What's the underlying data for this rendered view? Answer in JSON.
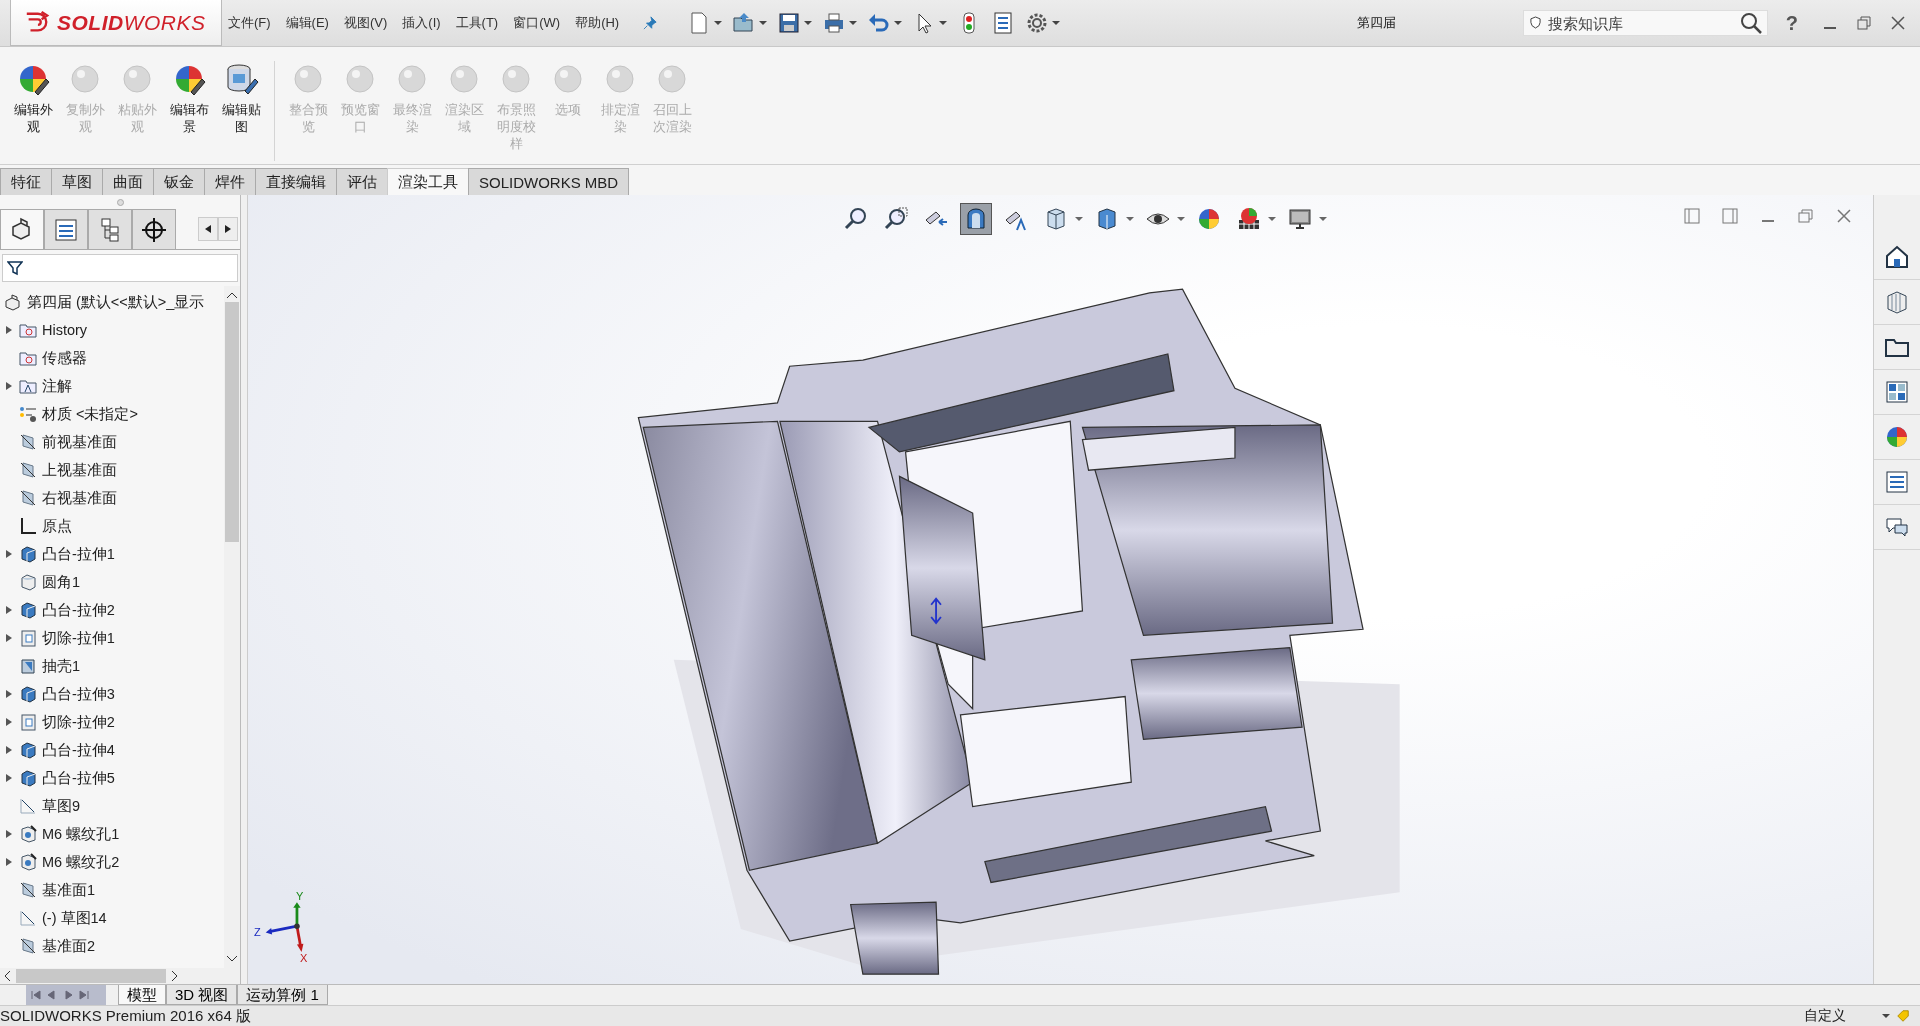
{
  "logo": "**SOLID**WORKS",
  "menu": [
    "文件(F)",
    "编辑(E)",
    "视图(V)",
    "插入(I)",
    "工具(T)",
    "窗口(W)",
    "帮助(H)"
  ],
  "quick_tools": [
    {
      "kind": "new",
      "dropdown": true
    },
    {
      "kind": "open",
      "dropdown": true
    },
    {
      "kind": "save",
      "dropdown": true
    },
    {
      "kind": "print",
      "dropdown": true
    },
    {
      "kind": "undo",
      "dropdown": true
    },
    {
      "kind": "select",
      "dropdown": true
    },
    {
      "kind": "rebuild",
      "dropdown": false
    },
    {
      "kind": "options-list",
      "dropdown": false
    },
    {
      "kind": "settings",
      "dropdown": true
    }
  ],
  "document_title": "第四届",
  "search": {
    "placeholder": "搜索知识库"
  },
  "help": "?",
  "ribbon": [
    {
      "label": "编辑外观",
      "disabled": false,
      "kind": "ball"
    },
    {
      "label": "复制外观",
      "disabled": true,
      "kind": "ball"
    },
    {
      "label": "粘贴外观",
      "disabled": true,
      "kind": "ball"
    },
    {
      "label": "编辑布景",
      "disabled": false,
      "kind": "ball"
    },
    {
      "label": "编辑贴图",
      "disabled": false,
      "kind": "decal"
    },
    {
      "label": "整合预览",
      "disabled": true,
      "kind": "ball"
    },
    {
      "label": "预览窗口",
      "disabled": true,
      "kind": "ball"
    },
    {
      "label": "最终渲染",
      "disabled": true,
      "kind": "ball"
    },
    {
      "label": "渲染区域",
      "disabled": true,
      "kind": "ball"
    },
    {
      "label": "布景照明度校样",
      "disabled": true,
      "kind": "ball"
    },
    {
      "label": "选项",
      "disabled": true,
      "kind": "ball"
    },
    {
      "label": "排定渲染",
      "disabled": true,
      "kind": "ball"
    },
    {
      "label": "召回上次渲染",
      "disabled": true,
      "kind": "ball"
    }
  ],
  "command_tabs": [
    {
      "label": "特征",
      "selected": false
    },
    {
      "label": "草图",
      "selected": false
    },
    {
      "label": "曲面",
      "selected": false
    },
    {
      "label": "钣金",
      "selected": false
    },
    {
      "label": "焊件",
      "selected": false
    },
    {
      "label": "直接编辑",
      "selected": false
    },
    {
      "label": "评估",
      "selected": false
    },
    {
      "label": "渲染工具",
      "selected": true
    },
    {
      "label": "SOLIDWORKS MBD",
      "selected": false
    }
  ],
  "panel_tabs": [
    {
      "kind": "feature-tree",
      "selected": true
    },
    {
      "kind": "property",
      "selected": false
    },
    {
      "kind": "config",
      "selected": false
    },
    {
      "kind": "dimxpert",
      "selected": false
    }
  ],
  "tree": {
    "root": "第四届  (默认<<默认>_显示",
    "items": [
      {
        "label": "History",
        "kind": "folder",
        "expandable": true
      },
      {
        "label": "传感器",
        "kind": "folder",
        "expandable": false
      },
      {
        "label": "注解",
        "kind": "annotation",
        "expandable": true
      },
      {
        "label": "材质 <未指定>",
        "kind": "material",
        "expandable": false
      },
      {
        "label": "前视基准面",
        "kind": "plane",
        "expandable": false
      },
      {
        "label": "上视基准面",
        "kind": "plane",
        "expandable": false
      },
      {
        "label": "右视基准面",
        "kind": "plane",
        "expandable": false
      },
      {
        "label": "原点",
        "kind": "origin",
        "expandable": false
      },
      {
        "label": "凸台-拉伸1",
        "kind": "boss",
        "expandable": true
      },
      {
        "label": "圆角1",
        "kind": "fillet",
        "expandable": false
      },
      {
        "label": "凸台-拉伸2",
        "kind": "boss",
        "expandable": true
      },
      {
        "label": "切除-拉伸1",
        "kind": "cut",
        "expandable": true
      },
      {
        "label": "抽壳1",
        "kind": "shell",
        "expandable": false
      },
      {
        "label": "凸台-拉伸3",
        "kind": "boss",
        "expandable": true
      },
      {
        "label": "切除-拉伸2",
        "kind": "cut",
        "expandable": true
      },
      {
        "label": "凸台-拉伸4",
        "kind": "boss",
        "expandable": true
      },
      {
        "label": "凸台-拉伸5",
        "kind": "boss",
        "expandable": true
      },
      {
        "label": "草图9",
        "kind": "sketch",
        "expandable": false
      },
      {
        "label": "M6 螺纹孔1",
        "kind": "hole",
        "expandable": true
      },
      {
        "label": "M6 螺纹孔2",
        "kind": "hole",
        "expandable": true
      },
      {
        "label": "基准面1",
        "kind": "plane",
        "expandable": false
      },
      {
        "label": "(-) 草图14",
        "kind": "sketch",
        "expandable": false
      },
      {
        "label": "基准面2",
        "kind": "plane",
        "expandable": false
      }
    ]
  },
  "view_tools": [
    {
      "kind": "zoom-fit",
      "selected": false,
      "dropdown": false
    },
    {
      "kind": "zoom-area",
      "selected": false,
      "dropdown": false
    },
    {
      "kind": "previous-view",
      "selected": false,
      "dropdown": false
    },
    {
      "kind": "section",
      "selected": true,
      "dropdown": false
    },
    {
      "kind": "dynamic-annotation",
      "selected": false,
      "dropdown": false
    },
    {
      "kind": "view-orientation",
      "selected": false,
      "dropdown": true
    },
    {
      "kind": "display-style",
      "selected": false,
      "dropdown": true
    },
    {
      "kind": "hide-show",
      "selected": false,
      "dropdown": true
    },
    {
      "kind": "appearance",
      "selected": false,
      "dropdown": false
    },
    {
      "kind": "scene",
      "selected": false,
      "dropdown": true
    },
    {
      "kind": "display",
      "selected": false,
      "dropdown": true
    }
  ],
  "task_pane": [
    {
      "kind": "home"
    },
    {
      "kind": "parts"
    },
    {
      "kind": "folder"
    },
    {
      "kind": "palette"
    },
    {
      "kind": "appearance"
    },
    {
      "kind": "properties"
    },
    {
      "kind": "forum"
    }
  ],
  "triad": {
    "x": "X",
    "y": "Y",
    "z": "Z"
  },
  "bottom_tabs": [
    {
      "label": "模型",
      "selected": true
    },
    {
      "label": "3D 视图",
      "selected": false
    },
    {
      "label": "运动算例 1",
      "selected": false
    }
  ],
  "status_bar": {
    "text": "SOLIDWORKS Premium 2016 x64 版",
    "units": "自定义"
  }
}
